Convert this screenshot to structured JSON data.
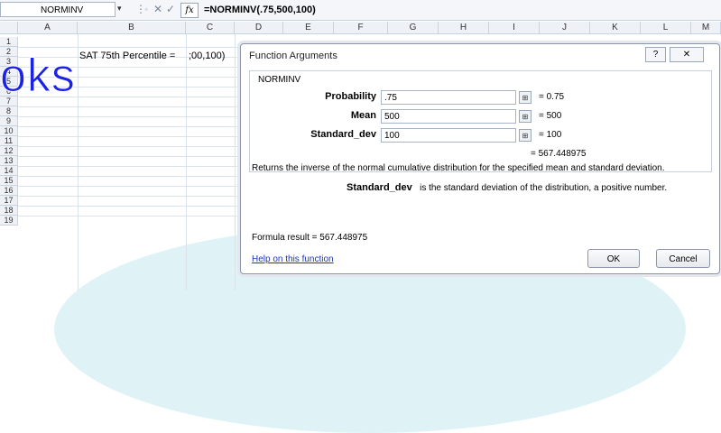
{
  "formula_bar": {
    "name_box": "NORMINV",
    "name_box_arrow": "▾",
    "cancel_glyph": "✕",
    "enter_glyph": "✓",
    "fx_glyph": "fx",
    "formula": "=NORMINV(.75,500,100)"
  },
  "sheet": {
    "columns": [
      "A",
      "B",
      "C",
      "D",
      "E",
      "F",
      "G",
      "H",
      "I",
      "J",
      "K",
      "L",
      "M"
    ],
    "rows": [
      "1",
      "2",
      "3",
      "4",
      "5",
      "6",
      "7",
      "8",
      "9",
      "10",
      "11",
      "12",
      "13",
      "14",
      "15",
      "16",
      "17",
      "18",
      "19"
    ],
    "cell_b2": "SAT 75th Percentile =",
    "cell_c2": ";00,100)",
    "watermark": "oks"
  },
  "dialog": {
    "title": "Function Arguments",
    "help_glyph": "?",
    "close_glyph": "✕",
    "function_name": "NORMINV",
    "args": [
      {
        "label": "Probability",
        "value": ".75",
        "result": "=  0.75",
        "btn": "⊞"
      },
      {
        "label": "Mean",
        "value": "500",
        "result": "=  500",
        "btn": "⊞"
      },
      {
        "label": "Standard_dev",
        "value": "100",
        "result": "=  100",
        "btn": "⊞"
      }
    ],
    "result_line": "=  567.448975",
    "description": "Returns the inverse of the normal cumulative distribution for the specified mean and standard deviation.",
    "arg_help_name": "Standard_dev",
    "arg_help_text": "is the standard deviation of the distribution, a positive number.",
    "formula_result": "Formula result =  567.448975",
    "help_link": "Help on this function",
    "ok_label": "OK",
    "cancel_label": "Cancel"
  },
  "colors": {
    "accent": "#1b22e6",
    "link": "#1c35b8"
  }
}
